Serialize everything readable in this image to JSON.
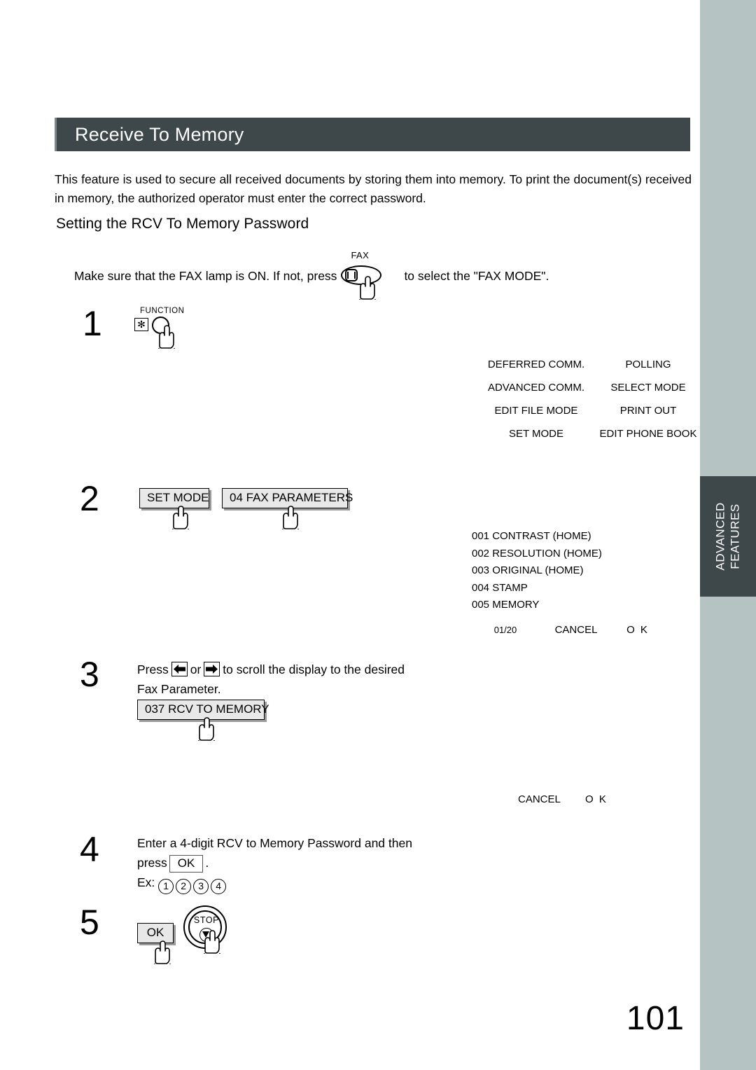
{
  "page": {
    "number": "101",
    "thumb_tab": "ADVANCED FEATURES",
    "thumb_tab_line1": "ADVANCED",
    "thumb_tab_line2": "FEATURES"
  },
  "header": {
    "title": "Receive To Memory"
  },
  "intro": {
    "paragraph": "This feature is used to secure all received documents by storing them into memory.  To print the document(s) received in memory, the authorized operator must enter the correct password."
  },
  "subheading": "Setting the RCV To Memory Password",
  "fax_mode_line": {
    "before": "Make sure that the FAX lamp is ON.  If not, press",
    "button_label": "FAX",
    "after": "to select the \"FAX MODE\"."
  },
  "steps": [
    {
      "number": "1",
      "key_label": "FUNCTION",
      "star_glyph": "✻"
    },
    {
      "number": "2",
      "buttons": [
        "SET MODE",
        "04 FAX PARAMETERS"
      ]
    },
    {
      "number": "3",
      "text_before": "Press",
      "text_middle": "or",
      "text_after": "to scroll the display to the desired",
      "text_line2": "Fax Parameter.",
      "button": "037 RCV TO MEMORY"
    },
    {
      "number": "4",
      "line1": "Enter a 4-digit RCV to Memory Password and then",
      "line2_before": "press",
      "line2_button": "OK",
      "line2_after": ".",
      "example_label": "Ex:",
      "example_digits": [
        "1",
        "2",
        "3",
        "4"
      ]
    },
    {
      "number": "5",
      "ok_button": "OK",
      "stop_button": "STOP"
    }
  ],
  "lcd_function_menu": {
    "rows": [
      {
        "left": "DEFERRED COMM.",
        "right": "POLLING"
      },
      {
        "left": "ADVANCED COMM.",
        "right": "SELECT MODE"
      },
      {
        "left": "EDIT FILE MODE",
        "right": "PRINT OUT"
      },
      {
        "left": "SET MODE",
        "right": "EDIT PHONE BOOK"
      }
    ]
  },
  "lcd_fax_parameters": {
    "items": [
      "001 CONTRAST (HOME)",
      "002 RESOLUTION (HOME)",
      "003 ORIGINAL (HOME)",
      "004 STAMP",
      "005 MEMORY"
    ],
    "page_indicator": "01/20",
    "cancel": "CANCEL",
    "ok": "O K"
  },
  "lcd_password_entry": {
    "cancel": "CANCEL",
    "ok": "O K"
  },
  "colors": {
    "header_bar": "#3e4749",
    "edge_strip": "#b5c3c2",
    "tab_background": "#3e4749"
  }
}
